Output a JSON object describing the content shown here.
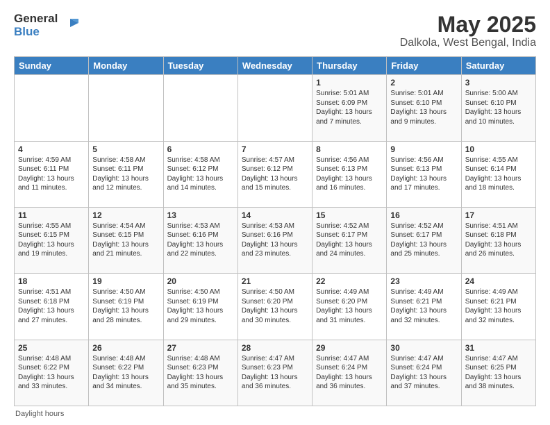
{
  "logo": {
    "line1": "General",
    "line2": "Blue"
  },
  "title": "May 2025",
  "subtitle": "Dalkola, West Bengal, India",
  "days_of_week": [
    "Sunday",
    "Monday",
    "Tuesday",
    "Wednesday",
    "Thursday",
    "Friday",
    "Saturday"
  ],
  "weeks": [
    [
      {
        "day": "",
        "info": ""
      },
      {
        "day": "",
        "info": ""
      },
      {
        "day": "",
        "info": ""
      },
      {
        "day": "",
        "info": ""
      },
      {
        "day": "1",
        "info": "Sunrise: 5:01 AM\nSunset: 6:09 PM\nDaylight: 13 hours and 7 minutes."
      },
      {
        "day": "2",
        "info": "Sunrise: 5:01 AM\nSunset: 6:10 PM\nDaylight: 13 hours and 9 minutes."
      },
      {
        "day": "3",
        "info": "Sunrise: 5:00 AM\nSunset: 6:10 PM\nDaylight: 13 hours and 10 minutes."
      }
    ],
    [
      {
        "day": "4",
        "info": "Sunrise: 4:59 AM\nSunset: 6:11 PM\nDaylight: 13 hours and 11 minutes."
      },
      {
        "day": "5",
        "info": "Sunrise: 4:58 AM\nSunset: 6:11 PM\nDaylight: 13 hours and 12 minutes."
      },
      {
        "day": "6",
        "info": "Sunrise: 4:58 AM\nSunset: 6:12 PM\nDaylight: 13 hours and 14 minutes."
      },
      {
        "day": "7",
        "info": "Sunrise: 4:57 AM\nSunset: 6:12 PM\nDaylight: 13 hours and 15 minutes."
      },
      {
        "day": "8",
        "info": "Sunrise: 4:56 AM\nSunset: 6:13 PM\nDaylight: 13 hours and 16 minutes."
      },
      {
        "day": "9",
        "info": "Sunrise: 4:56 AM\nSunset: 6:13 PM\nDaylight: 13 hours and 17 minutes."
      },
      {
        "day": "10",
        "info": "Sunrise: 4:55 AM\nSunset: 6:14 PM\nDaylight: 13 hours and 18 minutes."
      }
    ],
    [
      {
        "day": "11",
        "info": "Sunrise: 4:55 AM\nSunset: 6:15 PM\nDaylight: 13 hours and 19 minutes."
      },
      {
        "day": "12",
        "info": "Sunrise: 4:54 AM\nSunset: 6:15 PM\nDaylight: 13 hours and 21 minutes."
      },
      {
        "day": "13",
        "info": "Sunrise: 4:53 AM\nSunset: 6:16 PM\nDaylight: 13 hours and 22 minutes."
      },
      {
        "day": "14",
        "info": "Sunrise: 4:53 AM\nSunset: 6:16 PM\nDaylight: 13 hours and 23 minutes."
      },
      {
        "day": "15",
        "info": "Sunrise: 4:52 AM\nSunset: 6:17 PM\nDaylight: 13 hours and 24 minutes."
      },
      {
        "day": "16",
        "info": "Sunrise: 4:52 AM\nSunset: 6:17 PM\nDaylight: 13 hours and 25 minutes."
      },
      {
        "day": "17",
        "info": "Sunrise: 4:51 AM\nSunset: 6:18 PM\nDaylight: 13 hours and 26 minutes."
      }
    ],
    [
      {
        "day": "18",
        "info": "Sunrise: 4:51 AM\nSunset: 6:18 PM\nDaylight: 13 hours and 27 minutes."
      },
      {
        "day": "19",
        "info": "Sunrise: 4:50 AM\nSunset: 6:19 PM\nDaylight: 13 hours and 28 minutes."
      },
      {
        "day": "20",
        "info": "Sunrise: 4:50 AM\nSunset: 6:19 PM\nDaylight: 13 hours and 29 minutes."
      },
      {
        "day": "21",
        "info": "Sunrise: 4:50 AM\nSunset: 6:20 PM\nDaylight: 13 hours and 30 minutes."
      },
      {
        "day": "22",
        "info": "Sunrise: 4:49 AM\nSunset: 6:20 PM\nDaylight: 13 hours and 31 minutes."
      },
      {
        "day": "23",
        "info": "Sunrise: 4:49 AM\nSunset: 6:21 PM\nDaylight: 13 hours and 32 minutes."
      },
      {
        "day": "24",
        "info": "Sunrise: 4:49 AM\nSunset: 6:21 PM\nDaylight: 13 hours and 32 minutes."
      }
    ],
    [
      {
        "day": "25",
        "info": "Sunrise: 4:48 AM\nSunset: 6:22 PM\nDaylight: 13 hours and 33 minutes."
      },
      {
        "day": "26",
        "info": "Sunrise: 4:48 AM\nSunset: 6:22 PM\nDaylight: 13 hours and 34 minutes."
      },
      {
        "day": "27",
        "info": "Sunrise: 4:48 AM\nSunset: 6:23 PM\nDaylight: 13 hours and 35 minutes."
      },
      {
        "day": "28",
        "info": "Sunrise: 4:47 AM\nSunset: 6:23 PM\nDaylight: 13 hours and 36 minutes."
      },
      {
        "day": "29",
        "info": "Sunrise: 4:47 AM\nSunset: 6:24 PM\nDaylight: 13 hours and 36 minutes."
      },
      {
        "day": "30",
        "info": "Sunrise: 4:47 AM\nSunset: 6:24 PM\nDaylight: 13 hours and 37 minutes."
      },
      {
        "day": "31",
        "info": "Sunrise: 4:47 AM\nSunset: 6:25 PM\nDaylight: 13 hours and 38 minutes."
      }
    ]
  ],
  "footer": "Daylight hours"
}
